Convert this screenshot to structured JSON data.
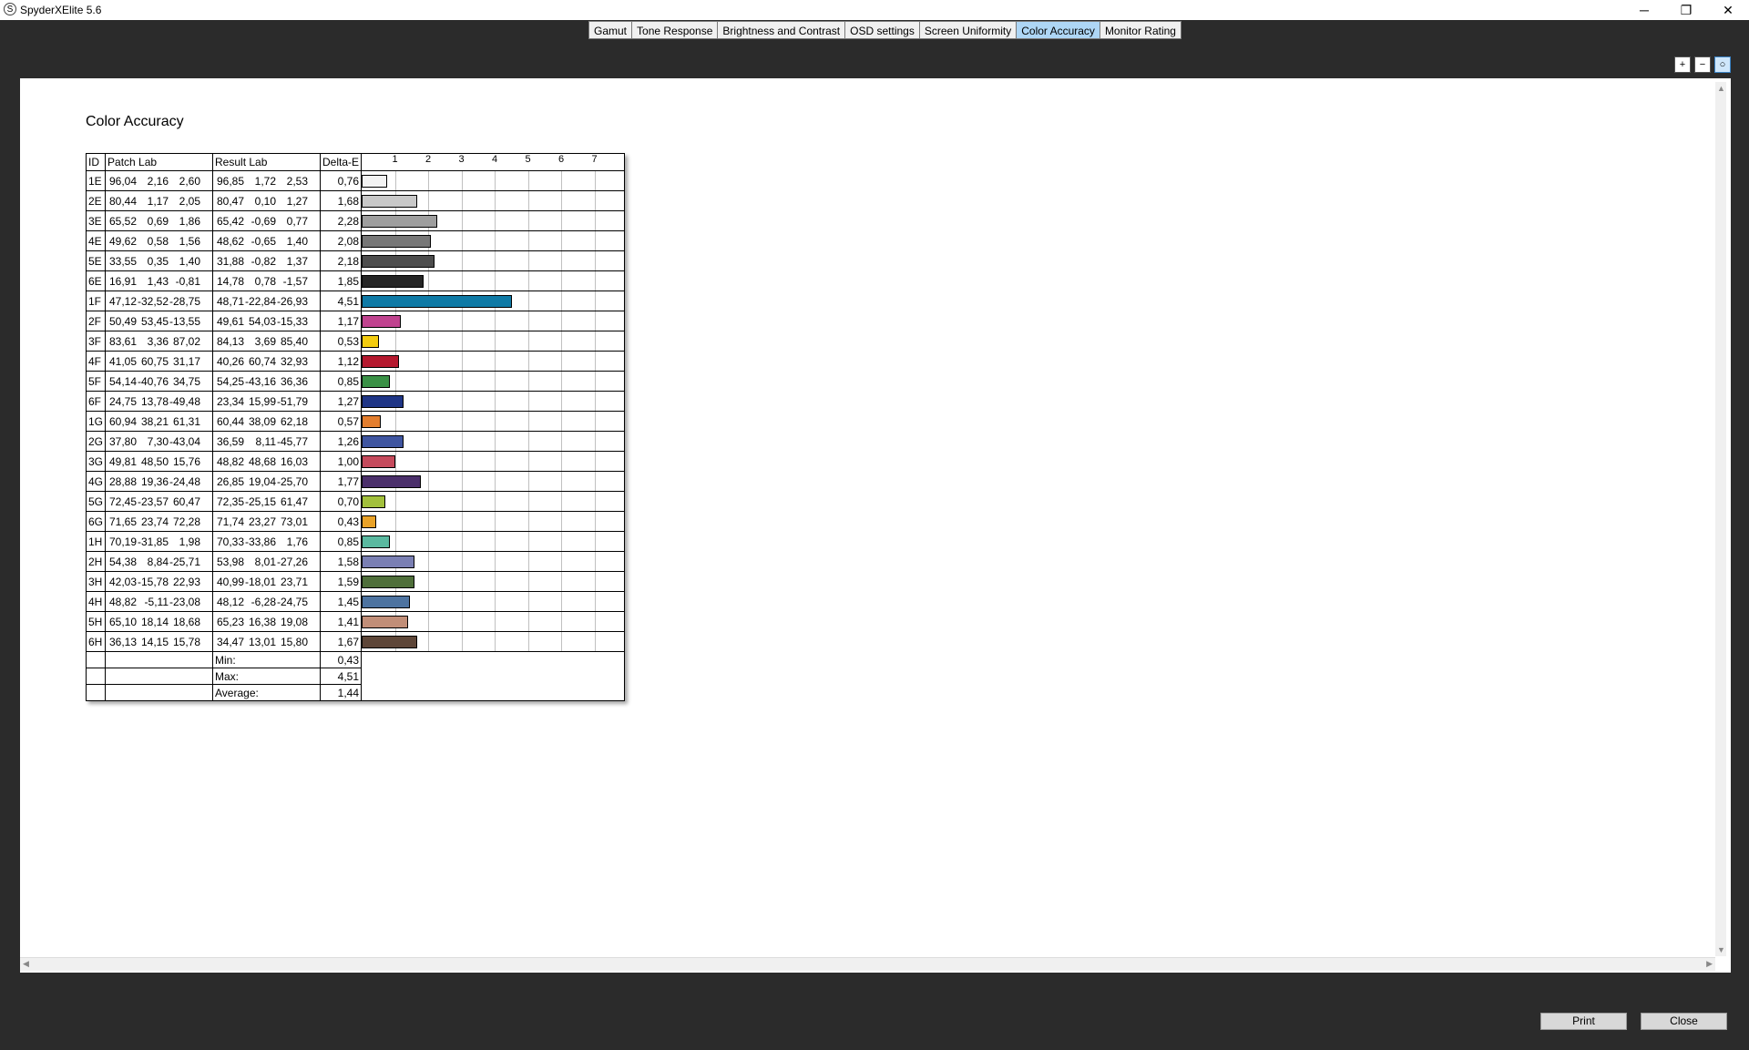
{
  "window": {
    "title": "SpyderXElite 5.6",
    "icon_letter": "S"
  },
  "tabs": [
    {
      "label": "Gamut",
      "active": false
    },
    {
      "label": "Tone Response",
      "active": false
    },
    {
      "label": "Brightness and Contrast",
      "active": false
    },
    {
      "label": "OSD settings",
      "active": false
    },
    {
      "label": "Screen Uniformity",
      "active": false
    },
    {
      "label": "Color Accuracy",
      "active": true
    },
    {
      "label": "Monitor Rating",
      "active": false
    }
  ],
  "report": {
    "title": "Color Accuracy",
    "headers": {
      "id": "ID",
      "patch": "Patch Lab",
      "result": "Result Lab",
      "delta": "Delta-E"
    },
    "axis_ticks": [
      "1",
      "2",
      "3",
      "4",
      "5",
      "6",
      "7"
    ],
    "rows": [
      {
        "id": "1E",
        "patch": [
          "96,04",
          "2,16",
          "2,60"
        ],
        "result": [
          "96,85",
          "1,72",
          "2,53"
        ],
        "de": "0,76",
        "color": "#f3f3f3"
      },
      {
        "id": "2E",
        "patch": [
          "80,44",
          "1,17",
          "2,05"
        ],
        "result": [
          "80,47",
          "0,10",
          "1,27"
        ],
        "de": "1,68",
        "color": "#c8c8c8"
      },
      {
        "id": "3E",
        "patch": [
          "65,52",
          "0,69",
          "1,86"
        ],
        "result": [
          "65,42",
          "-0,69",
          "0,77"
        ],
        "de": "2,28",
        "color": "#9e9e9e"
      },
      {
        "id": "4E",
        "patch": [
          "49,62",
          "0,58",
          "1,56"
        ],
        "result": [
          "48,62",
          "-0,65",
          "1,40"
        ],
        "de": "2,08",
        "color": "#777777"
      },
      {
        "id": "5E",
        "patch": [
          "33,55",
          "0,35",
          "1,40"
        ],
        "result": [
          "31,88",
          "-0,82",
          "1,37"
        ],
        "de": "2,18",
        "color": "#4d4d4d"
      },
      {
        "id": "6E",
        "patch": [
          "16,91",
          "1,43",
          "-0,81"
        ],
        "result": [
          "14,78",
          "0,78",
          "-1,57"
        ],
        "de": "1,85",
        "color": "#262626"
      },
      {
        "id": "1F",
        "patch": [
          "47,12",
          "-32,52",
          "-28,75"
        ],
        "result": [
          "48,71",
          "-22,84",
          "-26,93"
        ],
        "de": "4,51",
        "color": "#0f7aa6"
      },
      {
        "id": "2F",
        "patch": [
          "50,49",
          "53,45",
          "-13,55"
        ],
        "result": [
          "49,61",
          "54,03",
          "-15,33"
        ],
        "de": "1,17",
        "color": "#c0438f"
      },
      {
        "id": "3F",
        "patch": [
          "83,61",
          "3,36",
          "87,02"
        ],
        "result": [
          "84,13",
          "3,69",
          "85,40"
        ],
        "de": "0,53",
        "color": "#f3cc10"
      },
      {
        "id": "4F",
        "patch": [
          "41,05",
          "60,75",
          "31,17"
        ],
        "result": [
          "40,26",
          "60,74",
          "32,93"
        ],
        "de": "1,12",
        "color": "#b5192f"
      },
      {
        "id": "5F",
        "patch": [
          "54,14",
          "-40,76",
          "34,75"
        ],
        "result": [
          "54,25",
          "-43,16",
          "36,36"
        ],
        "de": "0,85",
        "color": "#3a9146"
      },
      {
        "id": "6F",
        "patch": [
          "24,75",
          "13,78",
          "-49,48"
        ],
        "result": [
          "23,34",
          "15,99",
          "-51,79"
        ],
        "de": "1,27",
        "color": "#1f3586"
      },
      {
        "id": "1G",
        "patch": [
          "60,94",
          "38,21",
          "61,31"
        ],
        "result": [
          "60,44",
          "38,09",
          "62,18"
        ],
        "de": "0,57",
        "color": "#e37e2e"
      },
      {
        "id": "2G",
        "patch": [
          "37,80",
          "7,30",
          "-43,04"
        ],
        "result": [
          "36,59",
          "8,11",
          "-45,77"
        ],
        "de": "1,26",
        "color": "#3f55a0"
      },
      {
        "id": "3G",
        "patch": [
          "49,81",
          "48,50",
          "15,76"
        ],
        "result": [
          "48,82",
          "48,68",
          "16,03"
        ],
        "de": "1,00",
        "color": "#c54a5c"
      },
      {
        "id": "4G",
        "patch": [
          "28,88",
          "19,36",
          "-24,48"
        ],
        "result": [
          "26,85",
          "19,04",
          "-25,70"
        ],
        "de": "1,77",
        "color": "#4b2f6b"
      },
      {
        "id": "5G",
        "patch": [
          "72,45",
          "-23,57",
          "60,47"
        ],
        "result": [
          "72,35",
          "-25,15",
          "61,47"
        ],
        "de": "0,70",
        "color": "#a2c03c"
      },
      {
        "id": "6G",
        "patch": [
          "71,65",
          "23,74",
          "72,28"
        ],
        "result": [
          "71,74",
          "23,27",
          "73,01"
        ],
        "de": "0,43",
        "color": "#e9a228"
      },
      {
        "id": "1H",
        "patch": [
          "70,19",
          "-31,85",
          "1,98"
        ],
        "result": [
          "70,33",
          "-33,86",
          "1,76"
        ],
        "de": "0,85",
        "color": "#5ab9a0"
      },
      {
        "id": "2H",
        "patch": [
          "54,38",
          "8,84",
          "-25,71"
        ],
        "result": [
          "53,98",
          "8,01",
          "-27,26"
        ],
        "de": "1,58",
        "color": "#7a7fb3"
      },
      {
        "id": "3H",
        "patch": [
          "42,03",
          "-15,78",
          "22,93"
        ],
        "result": [
          "40,99",
          "-18,01",
          "23,71"
        ],
        "de": "1,59",
        "color": "#4f6f3a"
      },
      {
        "id": "4H",
        "patch": [
          "48,82",
          "-5,11",
          "-23,08"
        ],
        "result": [
          "48,12",
          "-6,28",
          "-24,75"
        ],
        "de": "1,45",
        "color": "#4d73a0"
      },
      {
        "id": "5H",
        "patch": [
          "65,10",
          "18,14",
          "18,68"
        ],
        "result": [
          "65,23",
          "16,38",
          "19,08"
        ],
        "de": "1,41",
        "color": "#c18e78"
      },
      {
        "id": "6H",
        "patch": [
          "36,13",
          "14,15",
          "15,78"
        ],
        "result": [
          "34,47",
          "13,01",
          "15,80"
        ],
        "de": "1,67",
        "color": "#5e4638"
      }
    ],
    "summary": [
      {
        "label": "Min:",
        "value": "0,43"
      },
      {
        "label": "Max:",
        "value": "4,51"
      },
      {
        "label": "Average:",
        "value": "1,44"
      }
    ]
  },
  "buttons": {
    "print": "Print",
    "close": "Close"
  },
  "window_controls": {
    "minimize": "─",
    "restore": "❐",
    "close": "✕"
  },
  "zoom_icons": [
    "zoom-in-icon",
    "zoom-out-icon",
    "zoom-fit-icon"
  ]
}
